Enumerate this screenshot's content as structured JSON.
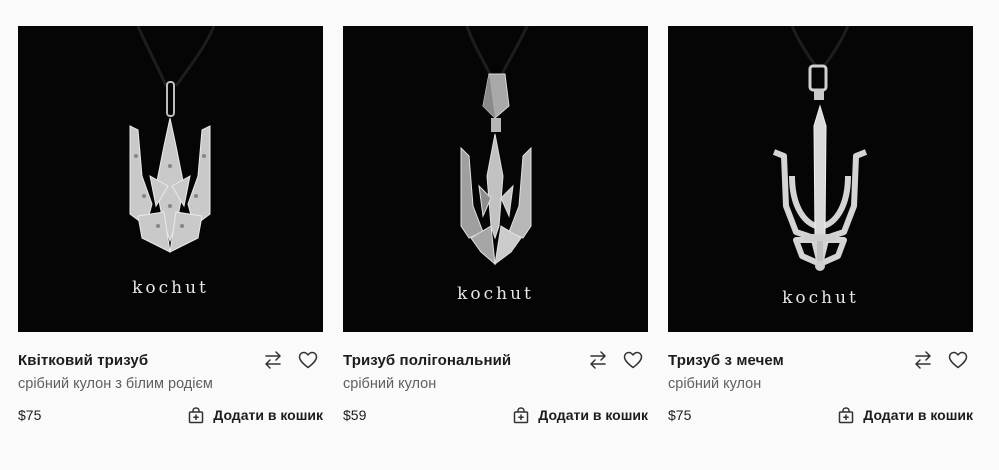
{
  "products": [
    {
      "name": "Квітковий тризуб",
      "description": "срібний кулон з білим родієм",
      "price": "$75",
      "cart_label": "Додати в кошик",
      "image_brand": "kochut",
      "image_icon": "trident-floral-pendant-icon"
    },
    {
      "name": "Тризуб полігональний",
      "description": "срібний кулон",
      "price": "$59",
      "cart_label": "Додати в кошик",
      "image_brand": "kochut",
      "image_icon": "trident-polygonal-pendant-icon"
    },
    {
      "name": "Тризуб з мечем",
      "description": "срібний кулон",
      "price": "$75",
      "cart_label": "Додати в кошик",
      "image_brand": "kochut",
      "image_icon": "trident-sword-pendant-icon"
    }
  ],
  "icons": {
    "compare": "compare-arrows-icon",
    "wishlist": "heart-icon",
    "cart": "shopping-bag-plus-icon"
  },
  "colors": {
    "image_background": "#050505",
    "silver": "#cfcfcf",
    "text": "#1c1c1c",
    "muted_text": "#5f5f5f",
    "page_background": "#fafafa"
  }
}
